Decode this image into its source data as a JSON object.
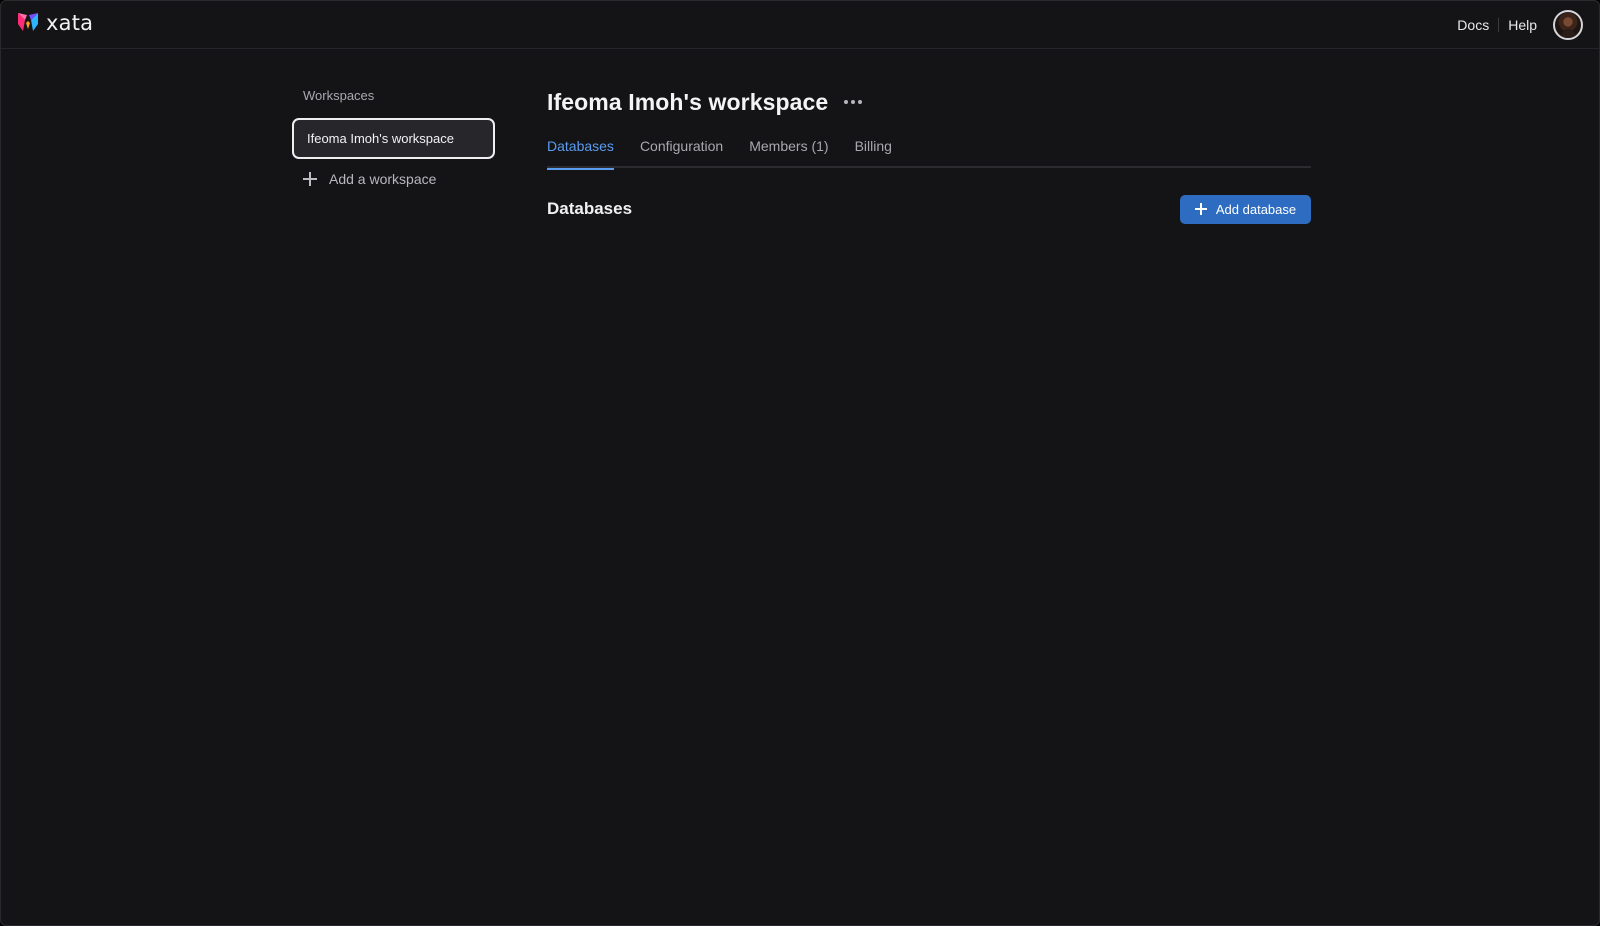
{
  "header": {
    "brand": "xata",
    "links": [
      "Docs",
      "Help"
    ],
    "logo_colors": [
      "#ff2d78",
      "#ff9f1a",
      "#2db4ff",
      "#7b4dff"
    ]
  },
  "sidebar": {
    "heading": "Workspaces",
    "items": [
      {
        "label": "Ifeoma Imoh's workspace",
        "selected": true
      }
    ],
    "add_label": "Add a workspace"
  },
  "main": {
    "title": "Ifeoma Imoh's workspace",
    "tabs": [
      {
        "label": "Databases",
        "active": true
      },
      {
        "label": "Configuration",
        "active": false
      },
      {
        "label": "Members (1)",
        "active": false
      },
      {
        "label": "Billing",
        "active": false
      }
    ],
    "section_title": "Databases",
    "add_database_label": "Add database"
  },
  "colors": {
    "background": "#141416",
    "accent": "#5b9bf0",
    "primary_button": "#2d6cc0"
  }
}
